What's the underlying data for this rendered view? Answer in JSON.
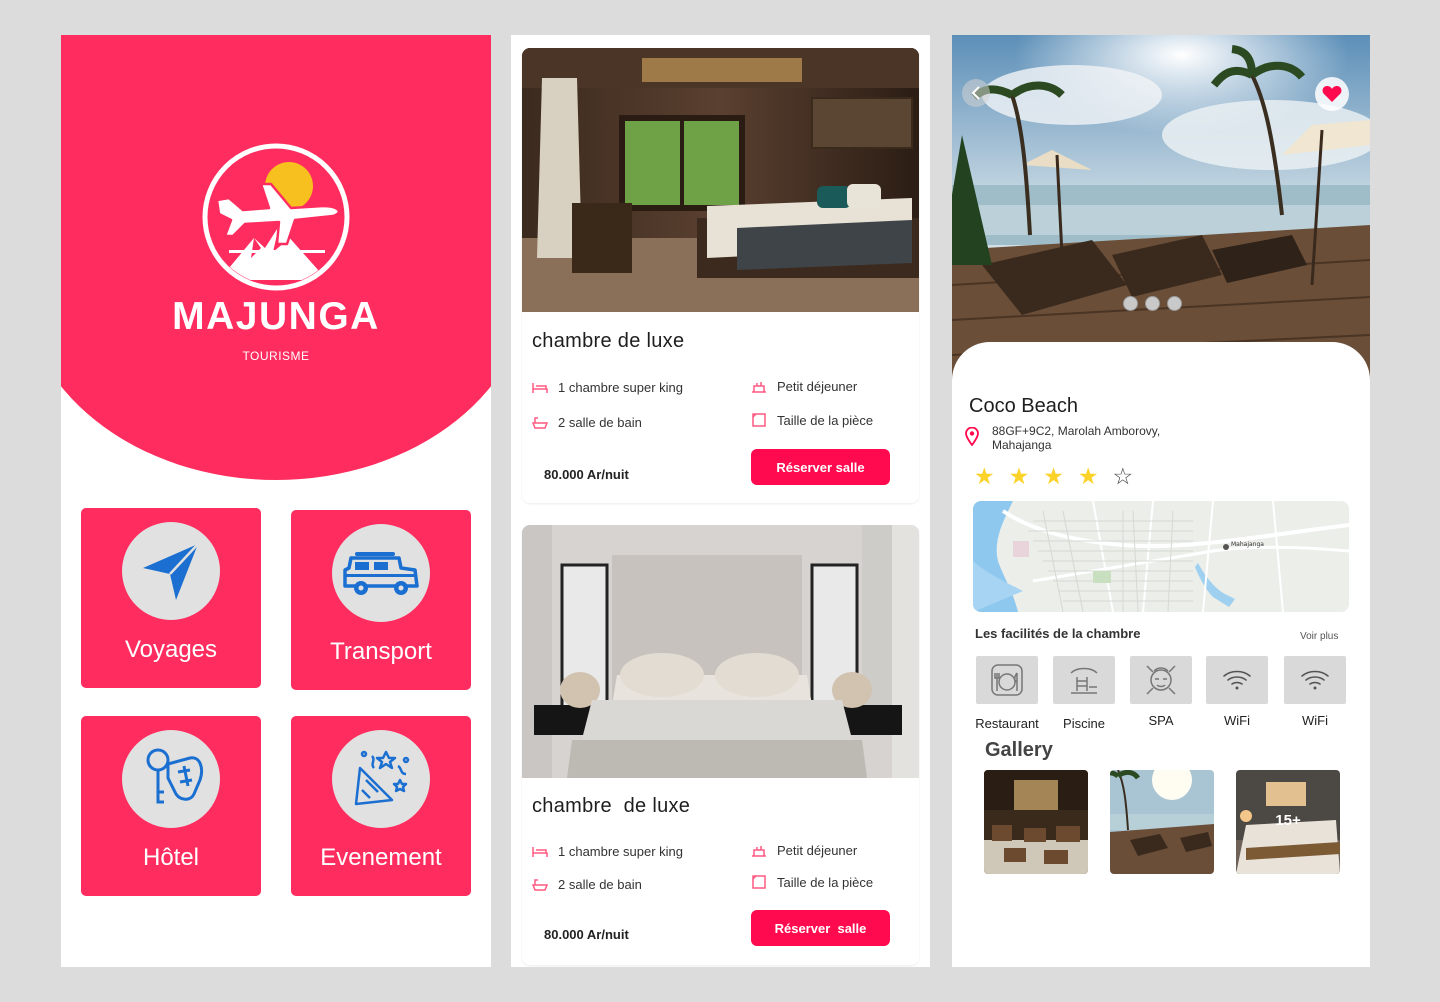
{
  "colors": {
    "brand": "#ff2d5f",
    "button": "#ff0a4e",
    "star": "#fbd22a",
    "icon_blue": "#1a6fd1"
  },
  "home": {
    "brand": "MAJUNGA",
    "tagline": "TOURISME",
    "tiles": [
      {
        "label": "Voyages",
        "icon": "paper-plane-icon"
      },
      {
        "label": "Transport",
        "icon": "jeep-icon"
      },
      {
        "label": "Hôtel",
        "icon": "hotel-key-icon"
      },
      {
        "label": "Evenement",
        "icon": "party-popper-icon"
      }
    ]
  },
  "rooms": [
    {
      "title": "chambre de luxe",
      "bed": "1 chambre super king",
      "bath": "2 salle de bain",
      "breakfast": "Petit déjeuner",
      "size": "Taille de la pièce",
      "price": "80.000 Ar/nuit",
      "button": "Réserver salle"
    },
    {
      "title": "chambre  de luxe",
      "bed": "1 chambre super king",
      "bath": "2 salle de bain",
      "breakfast": "Petit déjeuner",
      "size": "Taille de la pièce",
      "price": "80.000 Ar/nuit",
      "button": "Réserver  salle"
    }
  ],
  "detail": {
    "title": "Coco Beach",
    "address": "88GF+9C2, Marolah Amborovy, Mahajanga",
    "rating": 4,
    "rating_max": 5,
    "facilities_title": "Les facilités de la chambre",
    "see_more": "Voir plus",
    "facilities": [
      {
        "label": "Restaurant",
        "icon": "restaurant-icon"
      },
      {
        "label": "Piscine",
        "icon": "pool-icon"
      },
      {
        "label": "SPA",
        "icon": "spa-icon"
      },
      {
        "label": "WiFi",
        "icon": "wifi-icon"
      },
      {
        "label": "WiFi",
        "icon": "wifi-icon"
      }
    ],
    "gallery_title": "Gallery",
    "gallery_more": "15+",
    "map_label": "Mahajanga"
  }
}
